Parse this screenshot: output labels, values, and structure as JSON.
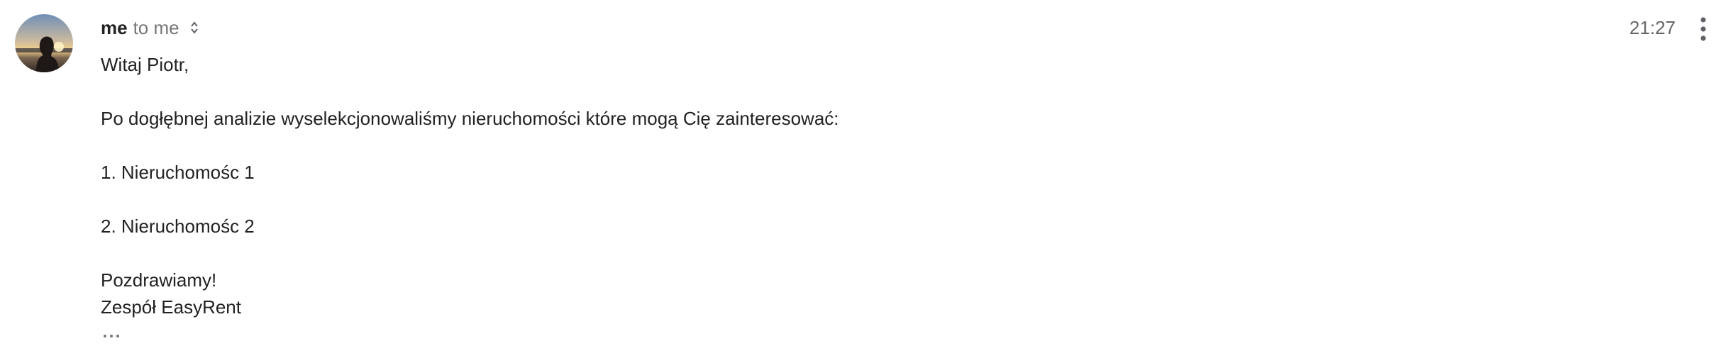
{
  "email": {
    "sender": "me",
    "recipient": "to me",
    "time": "21:27",
    "body": {
      "greeting": "Witaj Piotr,",
      "intro": "Po dogłębnej analizie wyselekcjonowaliśmy nieruchomości które mogą Cię zainteresować:",
      "items": [
        "1. Nieruchomośc 1",
        "2. Nieruchomośc 2"
      ],
      "closing": "Pozdrawiamy!",
      "signature": "Zespół EasyRent"
    }
  },
  "icons": {
    "details": "sort-arrows-icon",
    "more": "more-vertical-icon",
    "trimmed": "ellipsis-icon"
  },
  "colors": {
    "text": "#222222",
    "muted": "#777777",
    "icon": "#5f6368"
  }
}
